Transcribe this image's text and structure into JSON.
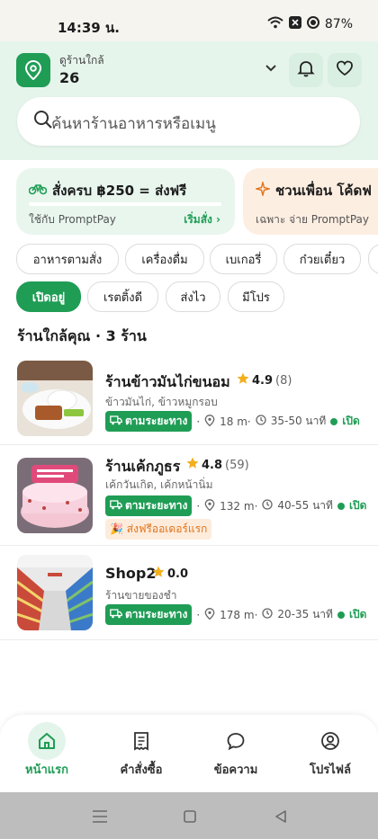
{
  "status": {
    "time": "14:39 น.",
    "battery": "87%"
  },
  "header": {
    "location_label": "ดูร้านใกล้",
    "location_value": "26",
    "search_placeholder": "ค้นหาร้านอาหารหรือเมนู"
  },
  "promos": [
    {
      "title": "สั่งครบ ฿250 = ส่งฟรี",
      "subtitle": "ใช้กับ PromptPay",
      "action": "เริ่มสั่ง",
      "progress": 0
    },
    {
      "title": "ชวนเพื่อน โค้ดฟ",
      "subtitle": "เฉพาะ จ่าย PromptPay"
    }
  ],
  "categories": [
    "อาหารตามสั่ง",
    "เครื่องดื่ม",
    "เบเกอรี่",
    "ก๋วยเตี๋ยว"
  ],
  "filters": [
    "เปิดอยู่",
    "เรตติ้งดี",
    "ส่งไว",
    "มีโปร"
  ],
  "section_title": "ร้านใกล้คุณ · 3 ร้าน",
  "restaurants": [
    {
      "name": "ร้านข้าวมันไก่ขนอม",
      "rating": "4.9",
      "count": "(8)",
      "desc": "ข้าวมันไก่, ข้าวหมูกรอบ",
      "tag": "ตามระยะทาง",
      "distance": "18 m·",
      "time": "35-50 นาที",
      "status": "เปิด"
    },
    {
      "name": "ร้านเค้กภูธร",
      "rating": "4.8",
      "count": "(59)",
      "desc": "เค้กวันเกิด, เค้กหน้านิ่ม",
      "tag": "ตามระยะทาง",
      "distance": "132 m·",
      "time": "40-55 นาที",
      "status": "เปิด",
      "badge": "🎉 ส่งฟรีออเดอร์แรก"
    },
    {
      "name": "Shop2",
      "rating": "0.0",
      "count": "",
      "desc": "ร้านขายของชำ",
      "tag": "ตามระยะทาง",
      "distance": "178 m·",
      "time": "20-35 นาที",
      "status": "เปิด"
    }
  ],
  "nav": [
    "หน้าแรก",
    "คำสั่งซื้อ",
    "ข้อความ",
    "โปรไฟล์"
  ],
  "colors": {
    "primary": "#1f9d55",
    "header_bg": "#e6f5ec",
    "star": "#f2b01e"
  }
}
